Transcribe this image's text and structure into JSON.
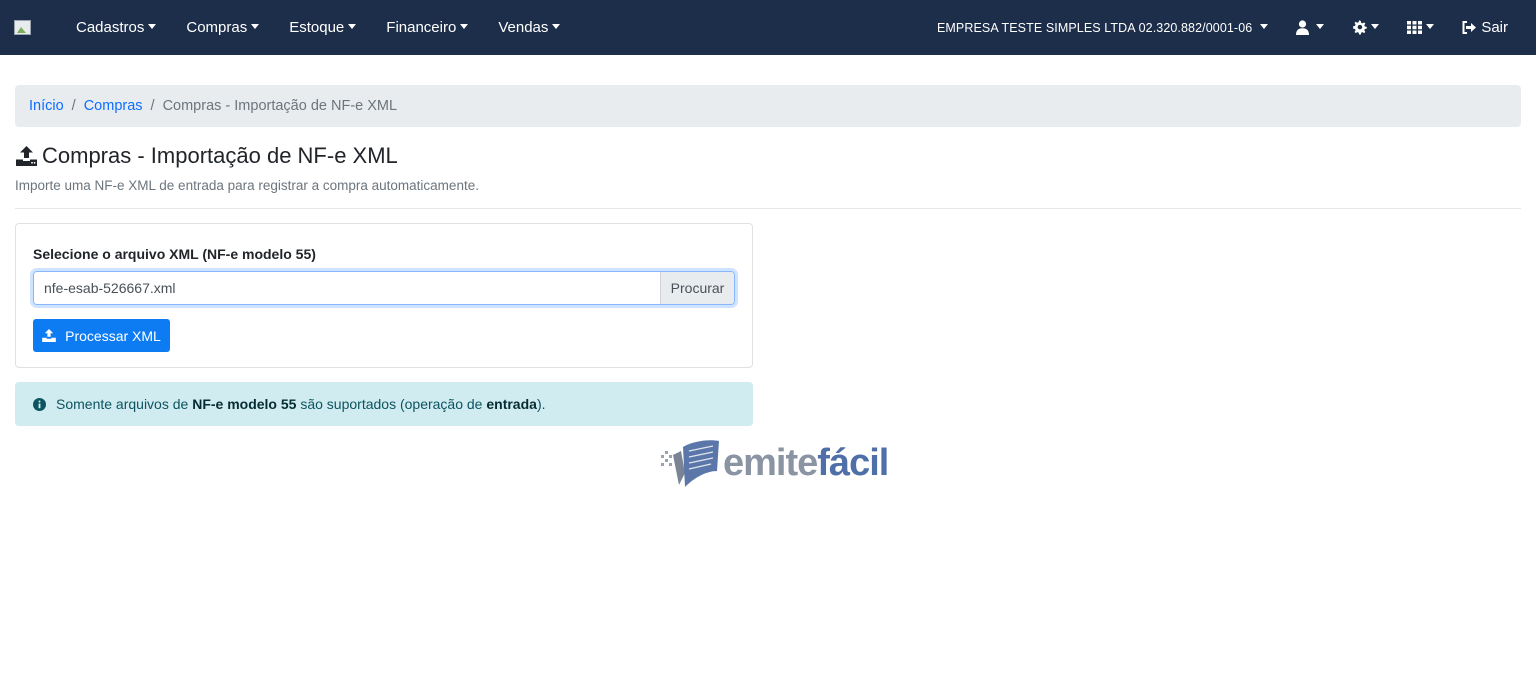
{
  "navbar": {
    "menu": [
      {
        "label": "Cadastros"
      },
      {
        "label": "Compras"
      },
      {
        "label": "Estoque"
      },
      {
        "label": "Financeiro"
      },
      {
        "label": "Vendas"
      }
    ],
    "company": "EMPRESA TESTE SIMPLES LTDA 02.320.882/0001-06",
    "logout_label": "Sair"
  },
  "breadcrumb": {
    "home": "Início",
    "section": "Compras",
    "current": "Compras - Importação de NF-e XML",
    "separator": "/"
  },
  "page": {
    "title": "Compras - Importação de NF-e XML",
    "subtitle": "Importe uma NF-e XML de entrada para registrar a compra automaticamente."
  },
  "form": {
    "file_label": "Selecione o arquivo XML (NF-e modelo 55)",
    "file_value": "nfe-esab-526667.xml",
    "browse_label": "Procurar",
    "submit_label": "Processar XML"
  },
  "alert": {
    "text_1": "Somente arquivos de",
    "bold_1": "NF-e modelo 55",
    "text_2": "são suportados (operação de",
    "bold_2": "entrada",
    "text_3": ")."
  },
  "footer_logo": {
    "part_1": "emite",
    "part_2": "fácil"
  },
  "colors": {
    "navbar_bg": "#1c2e4a",
    "primary": "#0d7cf2",
    "link": "#0d6efd",
    "alert_bg": "#d1ecf1",
    "breadcrumb_bg": "#e9ecef"
  }
}
